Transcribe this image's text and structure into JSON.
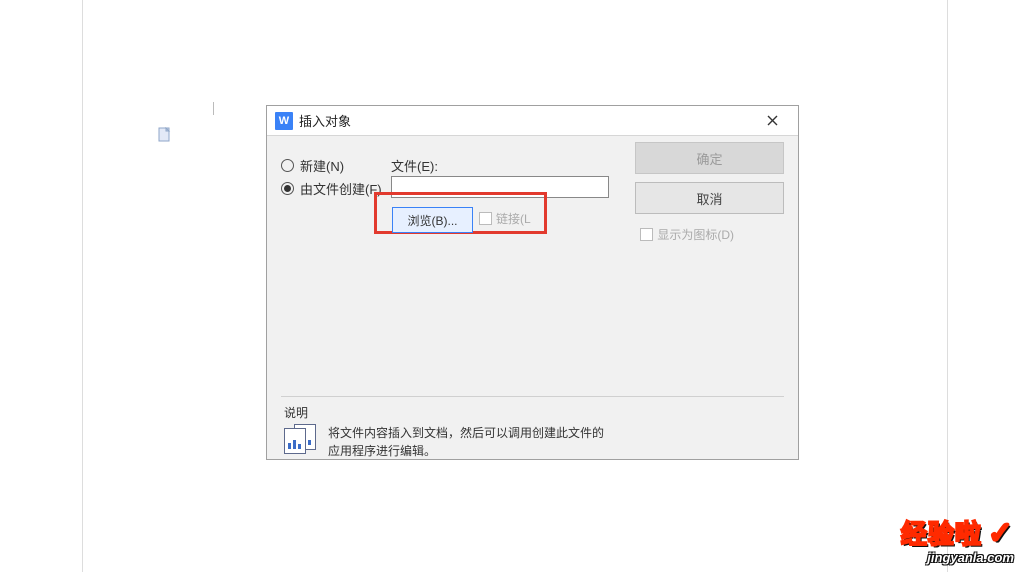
{
  "dialog": {
    "title": "插入对象",
    "title_icon_letter": "W",
    "radio_new_label": "新建(N)",
    "radio_from_file_label": "由文件创建(F)",
    "file_label": "文件(E):",
    "file_value": "",
    "browse_label": "浏览(B)...",
    "link_label": "链接(L",
    "ok_label": "确定",
    "cancel_label": "取消",
    "show_as_icon_label": "显示为图标(D)",
    "desc_heading": "说明",
    "desc_text": "将文件内容插入到文档，然后可以调用创建此文件的应用程序进行编辑。"
  },
  "watermark": {
    "top": "经验啦",
    "check": "✓",
    "bottom": "jingyanla.com"
  }
}
